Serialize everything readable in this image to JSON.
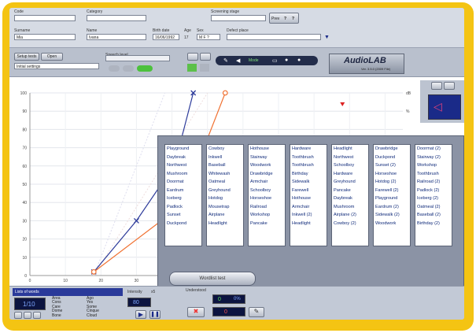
{
  "top": {
    "code_label": "Code",
    "category_label": "Category",
    "screening_label": "Screening stage",
    "prev_label": "Prev",
    "prev_q": "?",
    "next_q": "?",
    "surname_label": "Surname",
    "surname_value": "Mia",
    "name_label": "Name",
    "name_value": "Ivana",
    "birth_label": "Birth date",
    "birth_value": "16/06/1992",
    "age_label": "Age",
    "age_value": "17",
    "sex_label": "Sex",
    "sex_options": "M  F  ?",
    "defect_label": "Defect place"
  },
  "toolbar": {
    "setup_btn": "Setup tests",
    "open_btn": "Open",
    "initial_value": "Initial settings",
    "speech_label": "Speech level",
    "mode_label": "Mode",
    "logo": "AudioLAB",
    "version": "Ver. 3.5.0 (2009 File)"
  },
  "chart_data": {
    "type": "line",
    "xlim": [
      0,
      105
    ],
    "ylim": [
      0,
      100
    ],
    "y_ticks": [
      "0",
      "10",
      "20",
      "30",
      "40",
      "50",
      "60",
      "70",
      "80",
      "90",
      "100"
    ],
    "x_ticks": [
      "0",
      "10",
      "20",
      "30",
      "40"
    ],
    "right_top": "dB",
    "right_mid": "%",
    "series": [
      {
        "marker": "x",
        "color": "#2c3a9a",
        "x": [
          18,
          30,
          37,
          42,
          46
        ],
        "y": [
          2,
          30,
          50,
          70,
          100
        ]
      },
      {
        "marker": "o",
        "color": "#f07030",
        "x": [
          18,
          37,
          43,
          49,
          55
        ],
        "y": [
          2,
          30,
          50,
          70,
          100
        ]
      }
    ]
  },
  "words": {
    "columns": [
      [
        "Playground",
        "Daybreak",
        "Northwest",
        "Mushroom",
        "Doormat",
        "Eardrum",
        "Iceberg",
        "Padlock",
        "Sunset",
        "Duckpond"
      ],
      [
        "Cowboy",
        "Inkwell",
        "Baseball",
        "Whitewash",
        "Oatmeal",
        "Greyhound",
        "Hotdog",
        "Mousetrap",
        "Airplane",
        "Headlight"
      ],
      [
        "Hothouse",
        "Stairway",
        "Woodwork",
        "Drawbridge",
        "Armchair",
        "Schoolboy",
        "Horseshoe",
        "Railroad",
        "Workshop",
        "Pancake"
      ],
      [
        "Hardware",
        "Toothbrush",
        "Toothbrush",
        "Birthday",
        "Sidewalk",
        "Farewell",
        "Hothouse",
        "Armchair",
        "Inkwell (2)",
        "Headlight"
      ],
      [
        "Headlight",
        "Northwest",
        "Schoolboy",
        "Hardware",
        "Greyhound",
        "Pancake",
        "Daybreak",
        "Mushroom",
        "Airplane (2)",
        "Cowboy (2)"
      ],
      [
        "Drawbridge",
        "Duckpond",
        "Sunset (2)",
        "Horseshoe",
        "Hotdog (2)",
        "Farewell (2)",
        "Playground",
        "Eardrum (2)",
        "Sidewalk (2)",
        "Woodwork"
      ],
      [
        "Doormat (2)",
        "Stairway (2)",
        "Workshop",
        "Toothbrush",
        "Railroad (2)",
        "Padlock (2)",
        "Iceberg (2)",
        "Oatmeal (2)",
        "Baseball (2)",
        "Birthday (2)"
      ]
    ],
    "wordlist_btn": "Wordlist test"
  },
  "bottom": {
    "lists_label": "Lists of words",
    "list_counter": "1/10",
    "list_words": [
      [
        "Area",
        "Cons",
        "Care",
        "Dome",
        "Bone"
      ],
      [
        "Ago",
        "Yes",
        "Some",
        "Cinque",
        "Cloud"
      ]
    ],
    "intensity_label": "Intensity",
    "intensity_step": "x5",
    "intensity_value": "80",
    "understood_label": "Understood",
    "understood_value": "0",
    "understood_pct": "0%",
    "missed_value": "0"
  }
}
